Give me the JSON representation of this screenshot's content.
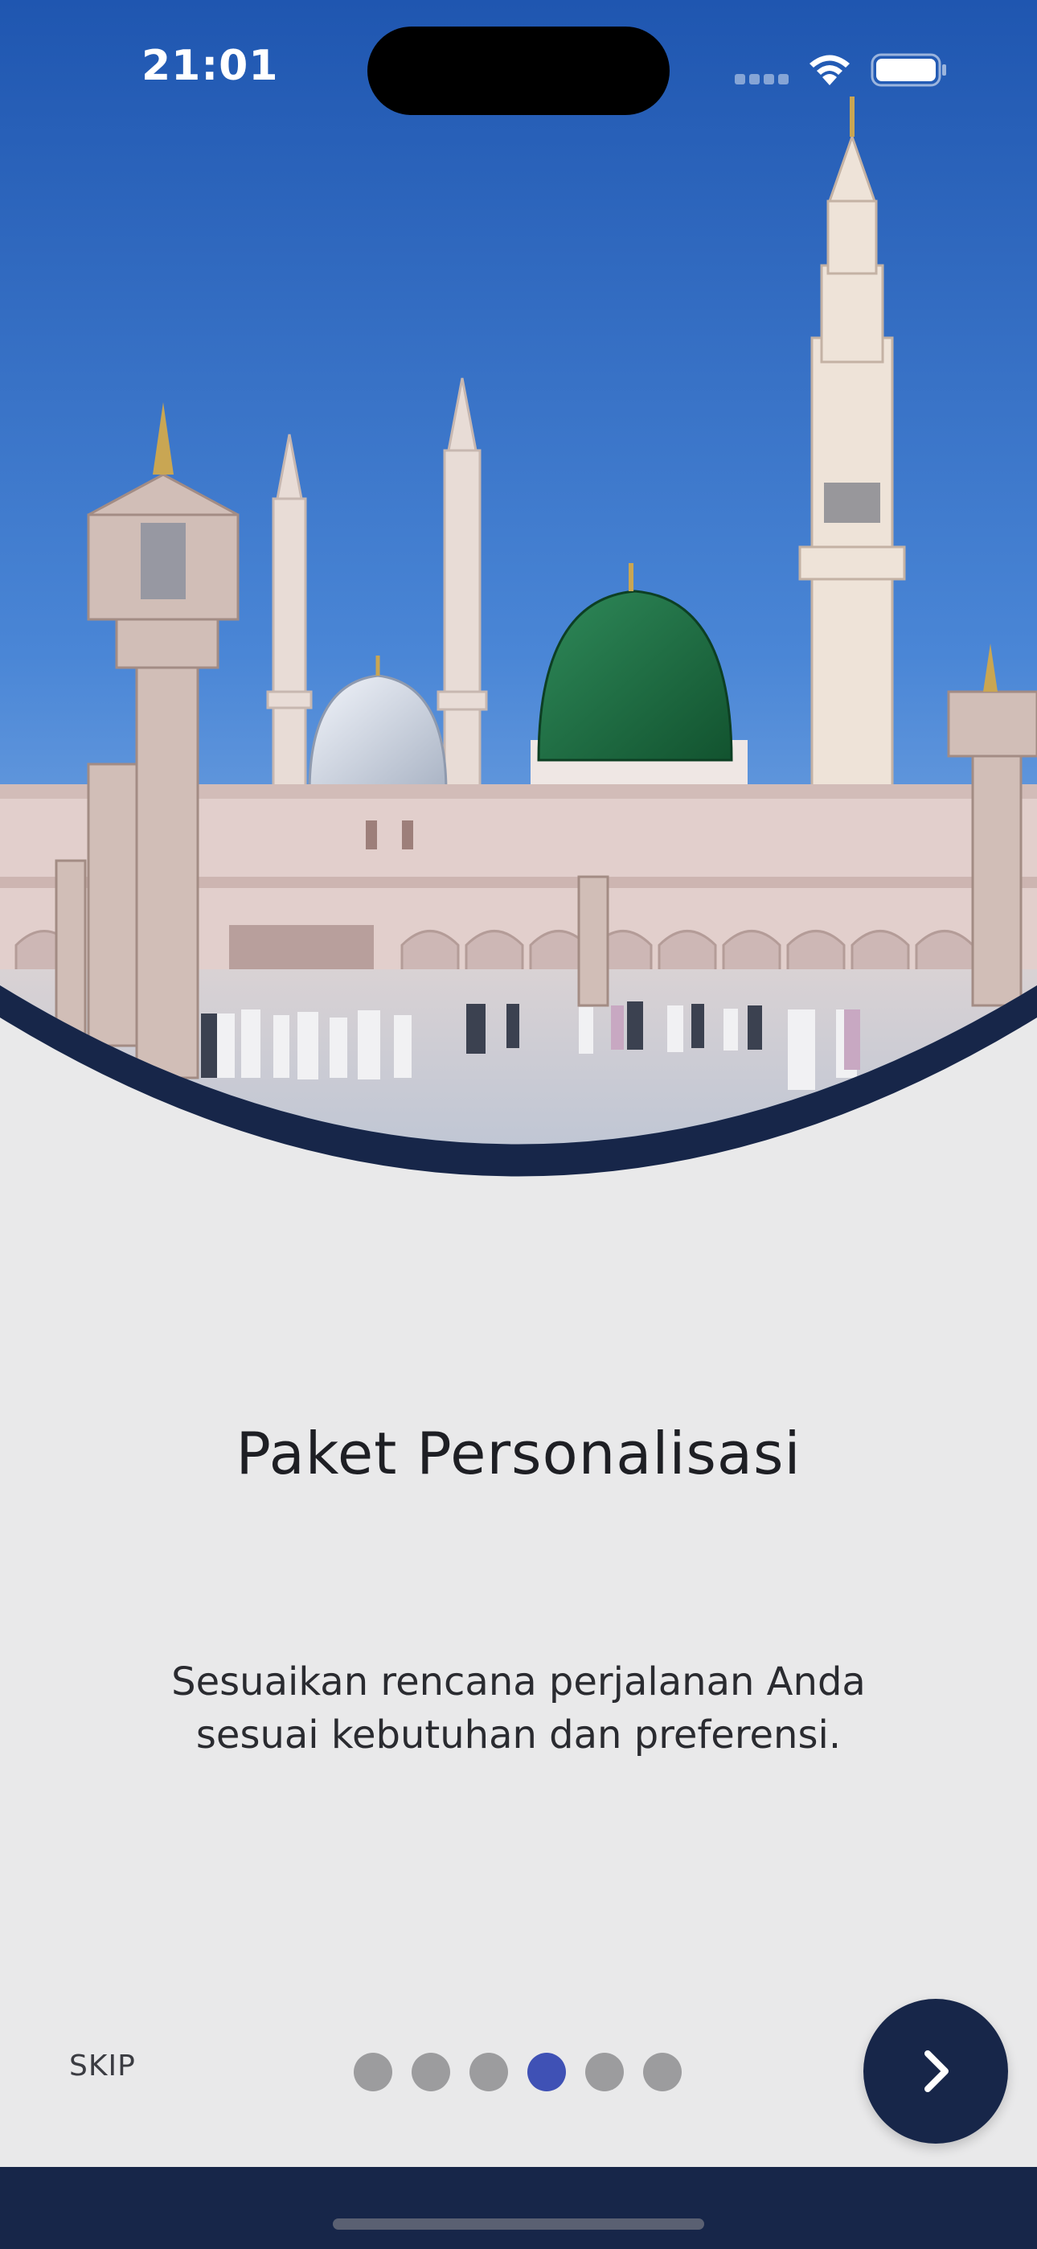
{
  "status_bar": {
    "time": "21:01"
  },
  "hero": {
    "image": "mosque-courtyard-illustration"
  },
  "onboarding": {
    "title": "Paket Personalisasi",
    "description": "Sesuaikan rencana perjalanan Anda sesuai kebutuhan dan preferensi.",
    "page_count": 6,
    "current_page": 4
  },
  "controls": {
    "skip_label": "SKIP",
    "next_icon": "chevron-right-icon"
  },
  "colors": {
    "primary": "#172649",
    "active_dot": "#3f51b5",
    "inactive_dot": "#9c9c9e",
    "background": "#e9e9ea"
  }
}
